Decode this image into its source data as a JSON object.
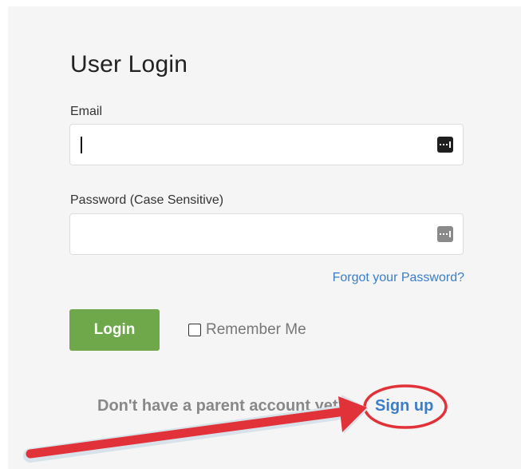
{
  "login": {
    "title": "User Login",
    "email_label": "Email",
    "email_value": "",
    "password_label": "Password (Case Sensitive)",
    "password_value": "",
    "forgot_link": "Forgot your Password?",
    "login_button": "Login",
    "remember_label": "Remember Me",
    "remember_checked": false,
    "signup_prompt": "Don't have a parent account yet?",
    "signup_link": "Sign up"
  },
  "icons": {
    "email_field_icon": "password-manager-key-icon",
    "password_field_icon": "password-manager-key-icon",
    "annotation": "red-arrow-and-circle-highlight"
  },
  "colors": {
    "panel_background": "#f5f5f5",
    "login_button": "#6ea84a",
    "link": "#3a7dc9",
    "annotation": "#e03238"
  }
}
